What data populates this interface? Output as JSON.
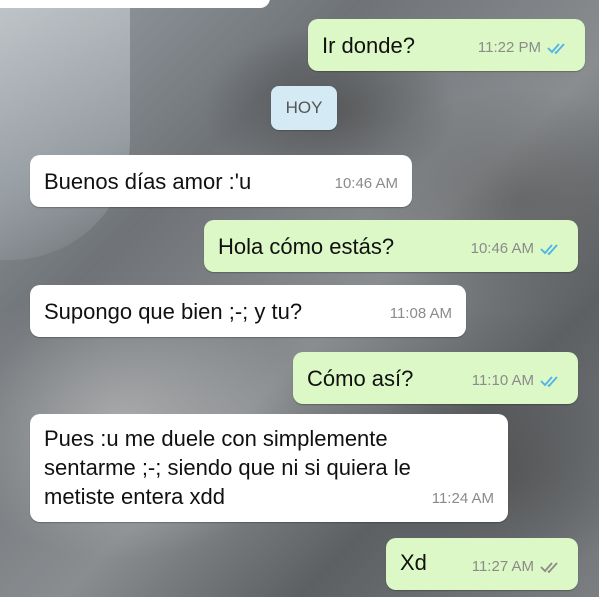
{
  "chat": {
    "date_label": "HOY",
    "messages": [
      {
        "text": "Ir donde?",
        "time": "11:22 PM",
        "outgoing": true
      },
      {
        "text": "Buenos días amor :'u",
        "time": "10:46 AM",
        "outgoing": false
      },
      {
        "text": "Hola cómo estás?",
        "time": "10:46 AM",
        "outgoing": true
      },
      {
        "text": "Supongo que bien ;-; y tu?",
        "time": "11:08 AM",
        "outgoing": false
      },
      {
        "text": "Cómo así?",
        "time": "11:10 AM",
        "outgoing": true
      },
      {
        "text": "Pues :u me duele con simplemente\nsentarme ;-; siendo que ni si quiera le\nmetiste entera xdd",
        "time": "11:24 AM",
        "outgoing": false
      },
      {
        "text": "Xd",
        "time": "11:27 AM",
        "outgoing": true
      }
    ]
  },
  "colors": {
    "outgoing_bubble": "#dcf8c6",
    "incoming_bubble": "#ffffff",
    "read_ticks": "#4fb3e6",
    "sent_ticks": "#8b8b8b"
  },
  "icons": {
    "read_receipt": "double-check-icon"
  }
}
